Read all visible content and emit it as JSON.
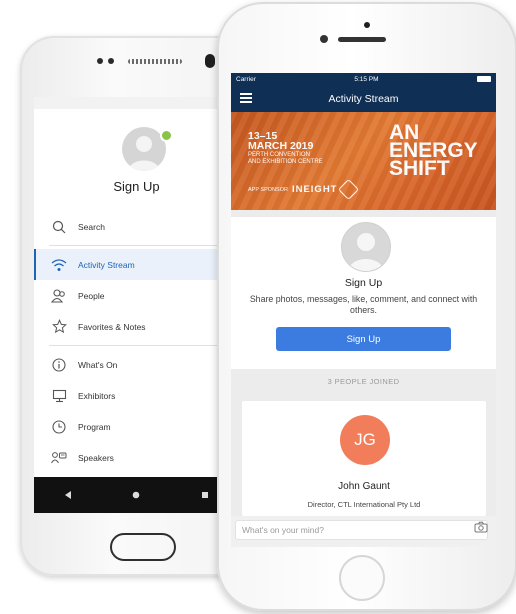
{
  "android": {
    "profile": {
      "title": "Sign Up"
    },
    "menu": [
      {
        "label": "Search",
        "icon": "search-icon"
      },
      {
        "label": "Activity Stream",
        "icon": "wifi-icon",
        "active": true
      },
      {
        "label": "People",
        "icon": "people-icon"
      },
      {
        "label": "Favorites & Notes",
        "icon": "star-icon"
      },
      {
        "label": "What's On",
        "icon": "info-icon"
      },
      {
        "label": "Exhibitors",
        "icon": "monitor-icon"
      },
      {
        "label": "Program",
        "icon": "clock-icon"
      },
      {
        "label": "Speakers",
        "icon": "speaker-icon"
      }
    ],
    "accent": "#1f63b6"
  },
  "iphone": {
    "status": {
      "carrier": "Carrier",
      "time": "5:15 PM"
    },
    "header": {
      "title": "Activity Stream"
    },
    "banner": {
      "date_line1": "13–15",
      "date_line2": "MARCH 2019",
      "venue_line1": "PERTH CONVENTION",
      "venue_line2": "AND EXHIBITION CENTRE",
      "sponsor_label": "APP SPONSOR",
      "sponsor_name": "INEIGHT",
      "word1": "AN",
      "word2": "ENERGY",
      "word3": "SHIFT"
    },
    "signup": {
      "title": "Sign Up",
      "description": "Share photos, messages, like, comment, and connect with others.",
      "button": "Sign Up"
    },
    "joined": {
      "label": "3 PEOPLE JOINED"
    },
    "person": {
      "initials": "JG",
      "name": "John Gaunt",
      "role": "Director, CTL International Pty Ltd"
    },
    "composer": {
      "placeholder": "What's on your mind?"
    },
    "colors": {
      "header": "#0f2f55",
      "button": "#3c7ce0",
      "avatar_jg": "#f27d5a",
      "banner": "#d9662a"
    }
  }
}
